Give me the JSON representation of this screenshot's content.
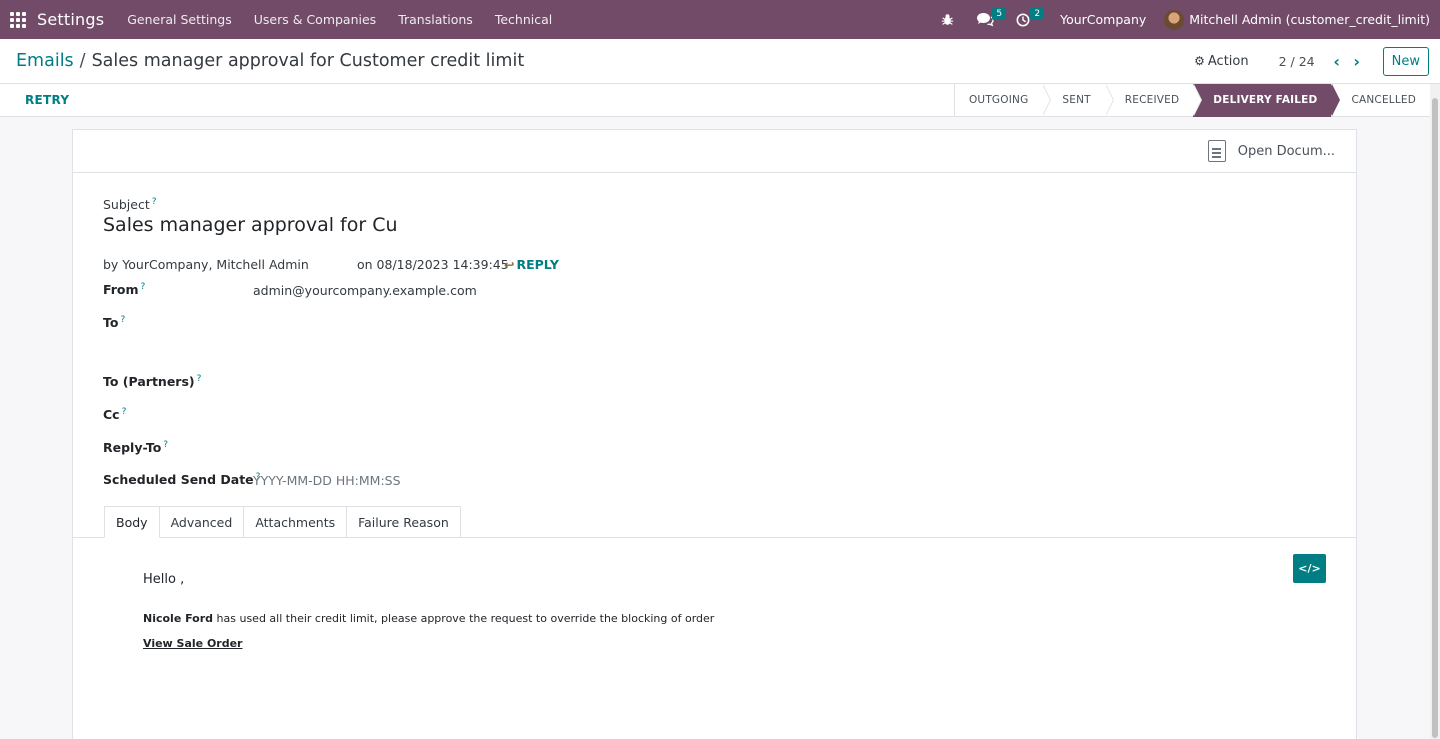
{
  "navbar": {
    "brand": "Settings",
    "menu": [
      "General Settings",
      "Users & Companies",
      "Translations",
      "Technical"
    ],
    "messages_count": "5",
    "activities_count": "2",
    "company": "YourCompany",
    "user": "Mitchell Admin (customer_credit_limit)",
    "brand_color": "#714b67"
  },
  "cpanel": {
    "breadcrumb_parent": "Emails",
    "breadcrumb_sep": "/",
    "breadcrumb_current": "Sales manager approval for Customer credit limit",
    "action_label": "Action",
    "pager": "2 / 24",
    "new_label": "New"
  },
  "statusbar": {
    "retry_label": "RETRY",
    "stages": [
      "OUTGOING",
      "SENT",
      "RECEIVED",
      "DELIVERY FAILED",
      "CANCELLED"
    ],
    "active_stage": "DELIVERY FAILED"
  },
  "sheet": {
    "open_document_label": "Open Docum...",
    "subject_label": "Subject",
    "subject_value": "Sales manager approval for Customer credit limit",
    "by_line": "by YourCompany, Mitchell Admin",
    "date_line": "on 08/18/2023 14:39:45",
    "reply_label": "REPLY",
    "from_label": "From",
    "from_value": "admin@yourcompany.example.com",
    "to_label": "To",
    "to_partners_label": "To (Partners)",
    "cc_label": "Cc",
    "reply_to_label": "Reply-To",
    "scheduled_label": "Scheduled Send Date",
    "scheduled_placeholder": "YYYY-MM-DD HH:MM:SS",
    "help_mark": "?",
    "tabs": [
      "Body",
      "Advanced",
      "Attachments",
      "Failure Reason"
    ],
    "active_tab": "Body",
    "code_label": "</>"
  },
  "body": {
    "hello": "Hello ,",
    "customer": "Nicole Ford",
    "message": " has used all their credit limit, please approve the request to override the blocking of order",
    "link": "View Sale Order"
  },
  "colors": {
    "accent": "#017e84",
    "brand": "#714b67"
  }
}
